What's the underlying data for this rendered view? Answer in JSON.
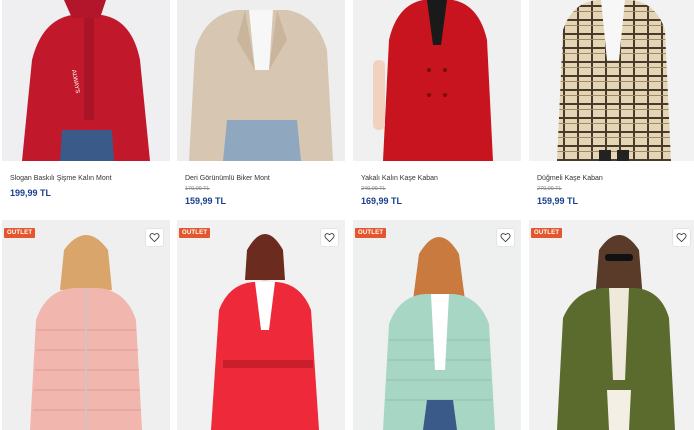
{
  "products_top": [
    {
      "name": "Slogan Baskılı Şişme Kalın Mont",
      "old_price": "",
      "price": "199,99 TL"
    },
    {
      "name": "Deri Görünümlü Biker Mont",
      "old_price": "179,99 TL",
      "price": "159,99 TL"
    },
    {
      "name": "Yakalı Kalın Kaşe Kaban",
      "old_price": "249,99 TL",
      "price": "169,99 TL"
    },
    {
      "name": "Düğmeli Kaşe Kaban",
      "old_price": "279,99 TL",
      "price": "159,99 TL"
    }
  ],
  "products_bottom": [
    {
      "badge": "OUTLET",
      "fav_icon": "heart-icon"
    },
    {
      "badge": "OUTLET",
      "fav_icon": "heart-icon"
    },
    {
      "badge": "OUTLET",
      "fav_icon": "heart-icon"
    },
    {
      "badge": "OUTLET",
      "fav_icon": "heart-icon"
    }
  ],
  "colors": {
    "price": "#1a3f8f",
    "badge": "#e4572e"
  }
}
